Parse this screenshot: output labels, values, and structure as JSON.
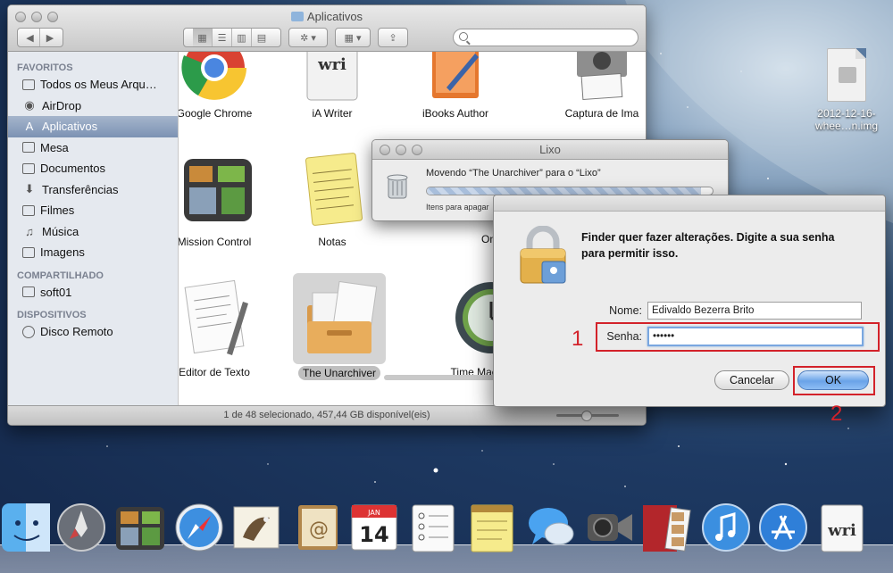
{
  "finder": {
    "title": "Aplicativos",
    "search_placeholder": "",
    "sidebar": {
      "sections": [
        {
          "header": "FAVORITOS",
          "items": [
            {
              "label": "Todos os Meus Arqu…",
              "icon": "all-files-icon"
            },
            {
              "label": "AirDrop",
              "icon": "airdrop-icon"
            },
            {
              "label": "Aplicativos",
              "icon": "applications-icon",
              "selected": true
            },
            {
              "label": "Mesa",
              "icon": "desktop-icon"
            },
            {
              "label": "Documentos",
              "icon": "documents-icon"
            },
            {
              "label": "Transferências",
              "icon": "downloads-icon"
            },
            {
              "label": "Filmes",
              "icon": "movies-icon"
            },
            {
              "label": "Música",
              "icon": "music-icon"
            },
            {
              "label": "Imagens",
              "icon": "pictures-icon"
            }
          ]
        },
        {
          "header": "COMPARTILHADO",
          "items": [
            {
              "label": "soft01",
              "icon": "shared-computer-icon"
            }
          ]
        },
        {
          "header": "DISPOSITIVOS",
          "items": [
            {
              "label": "Disco Remoto",
              "icon": "remote-disc-icon"
            }
          ]
        }
      ]
    },
    "apps": [
      {
        "label": "Google Chrome",
        "icon": "chrome-icon"
      },
      {
        "label": "iA Writer",
        "icon": "ia-writer-icon"
      },
      {
        "label": "iBooks Author",
        "icon": "ibooks-author-icon"
      },
      {
        "label": "Captura de Ima",
        "icon": "image-capture-icon"
      },
      {
        "label": "Mission Control",
        "icon": "mission-control-icon"
      },
      {
        "label": "Notas",
        "icon": "notes-icon"
      },
      {
        "label": "OnyX",
        "icon": "onyx-icon"
      },
      {
        "label": "Editor de Texto",
        "icon": "textedit-icon"
      },
      {
        "label": "The Unarchiver",
        "icon": "unarchiver-icon",
        "selected": true
      },
      {
        "label": "Time Mach",
        "icon": "time-machine-icon"
      }
    ],
    "status": "1 de 48 selecionado, 457,44 GB disponível(eis)"
  },
  "trash": {
    "title": "Lixo",
    "message": "Movendo “The Unarchiver” para o “Lixo”",
    "sub": "Itens para apagar",
    "progress": 0.96
  },
  "auth": {
    "prompt": "Finder quer fazer alterações. Digite a sua senha para permitir isso.",
    "name_label": "Nome:",
    "name_value": "Edivaldo Bezerra Brito",
    "password_label": "Senha:",
    "password_value": "••••••",
    "cancel_label": "Cancelar",
    "ok_label": "OK",
    "annotation_1": "1",
    "annotation_2": "2"
  },
  "desktop": {
    "file_label_line1": "2012-12-16-",
    "file_label_line2": "whee…n.img"
  },
  "dock": {
    "items": [
      "finder-icon",
      "launchpad-icon",
      "mission-control-icon",
      "safari-icon",
      "mail-icon",
      "contacts-icon",
      "calendar-icon",
      "reminders-icon",
      "notes-icon",
      "messages-icon",
      "facetime-icon",
      "photo-booth-icon",
      "itunes-icon",
      "app-store-icon",
      "ia-writer-icon"
    ],
    "calendar_month": "JAN",
    "calendar_day": "14",
    "writer_text": "wri"
  },
  "colors": {
    "annotation": "#d3222a",
    "selection": "#7c92b3",
    "ok_button": "#6aa3e8"
  }
}
